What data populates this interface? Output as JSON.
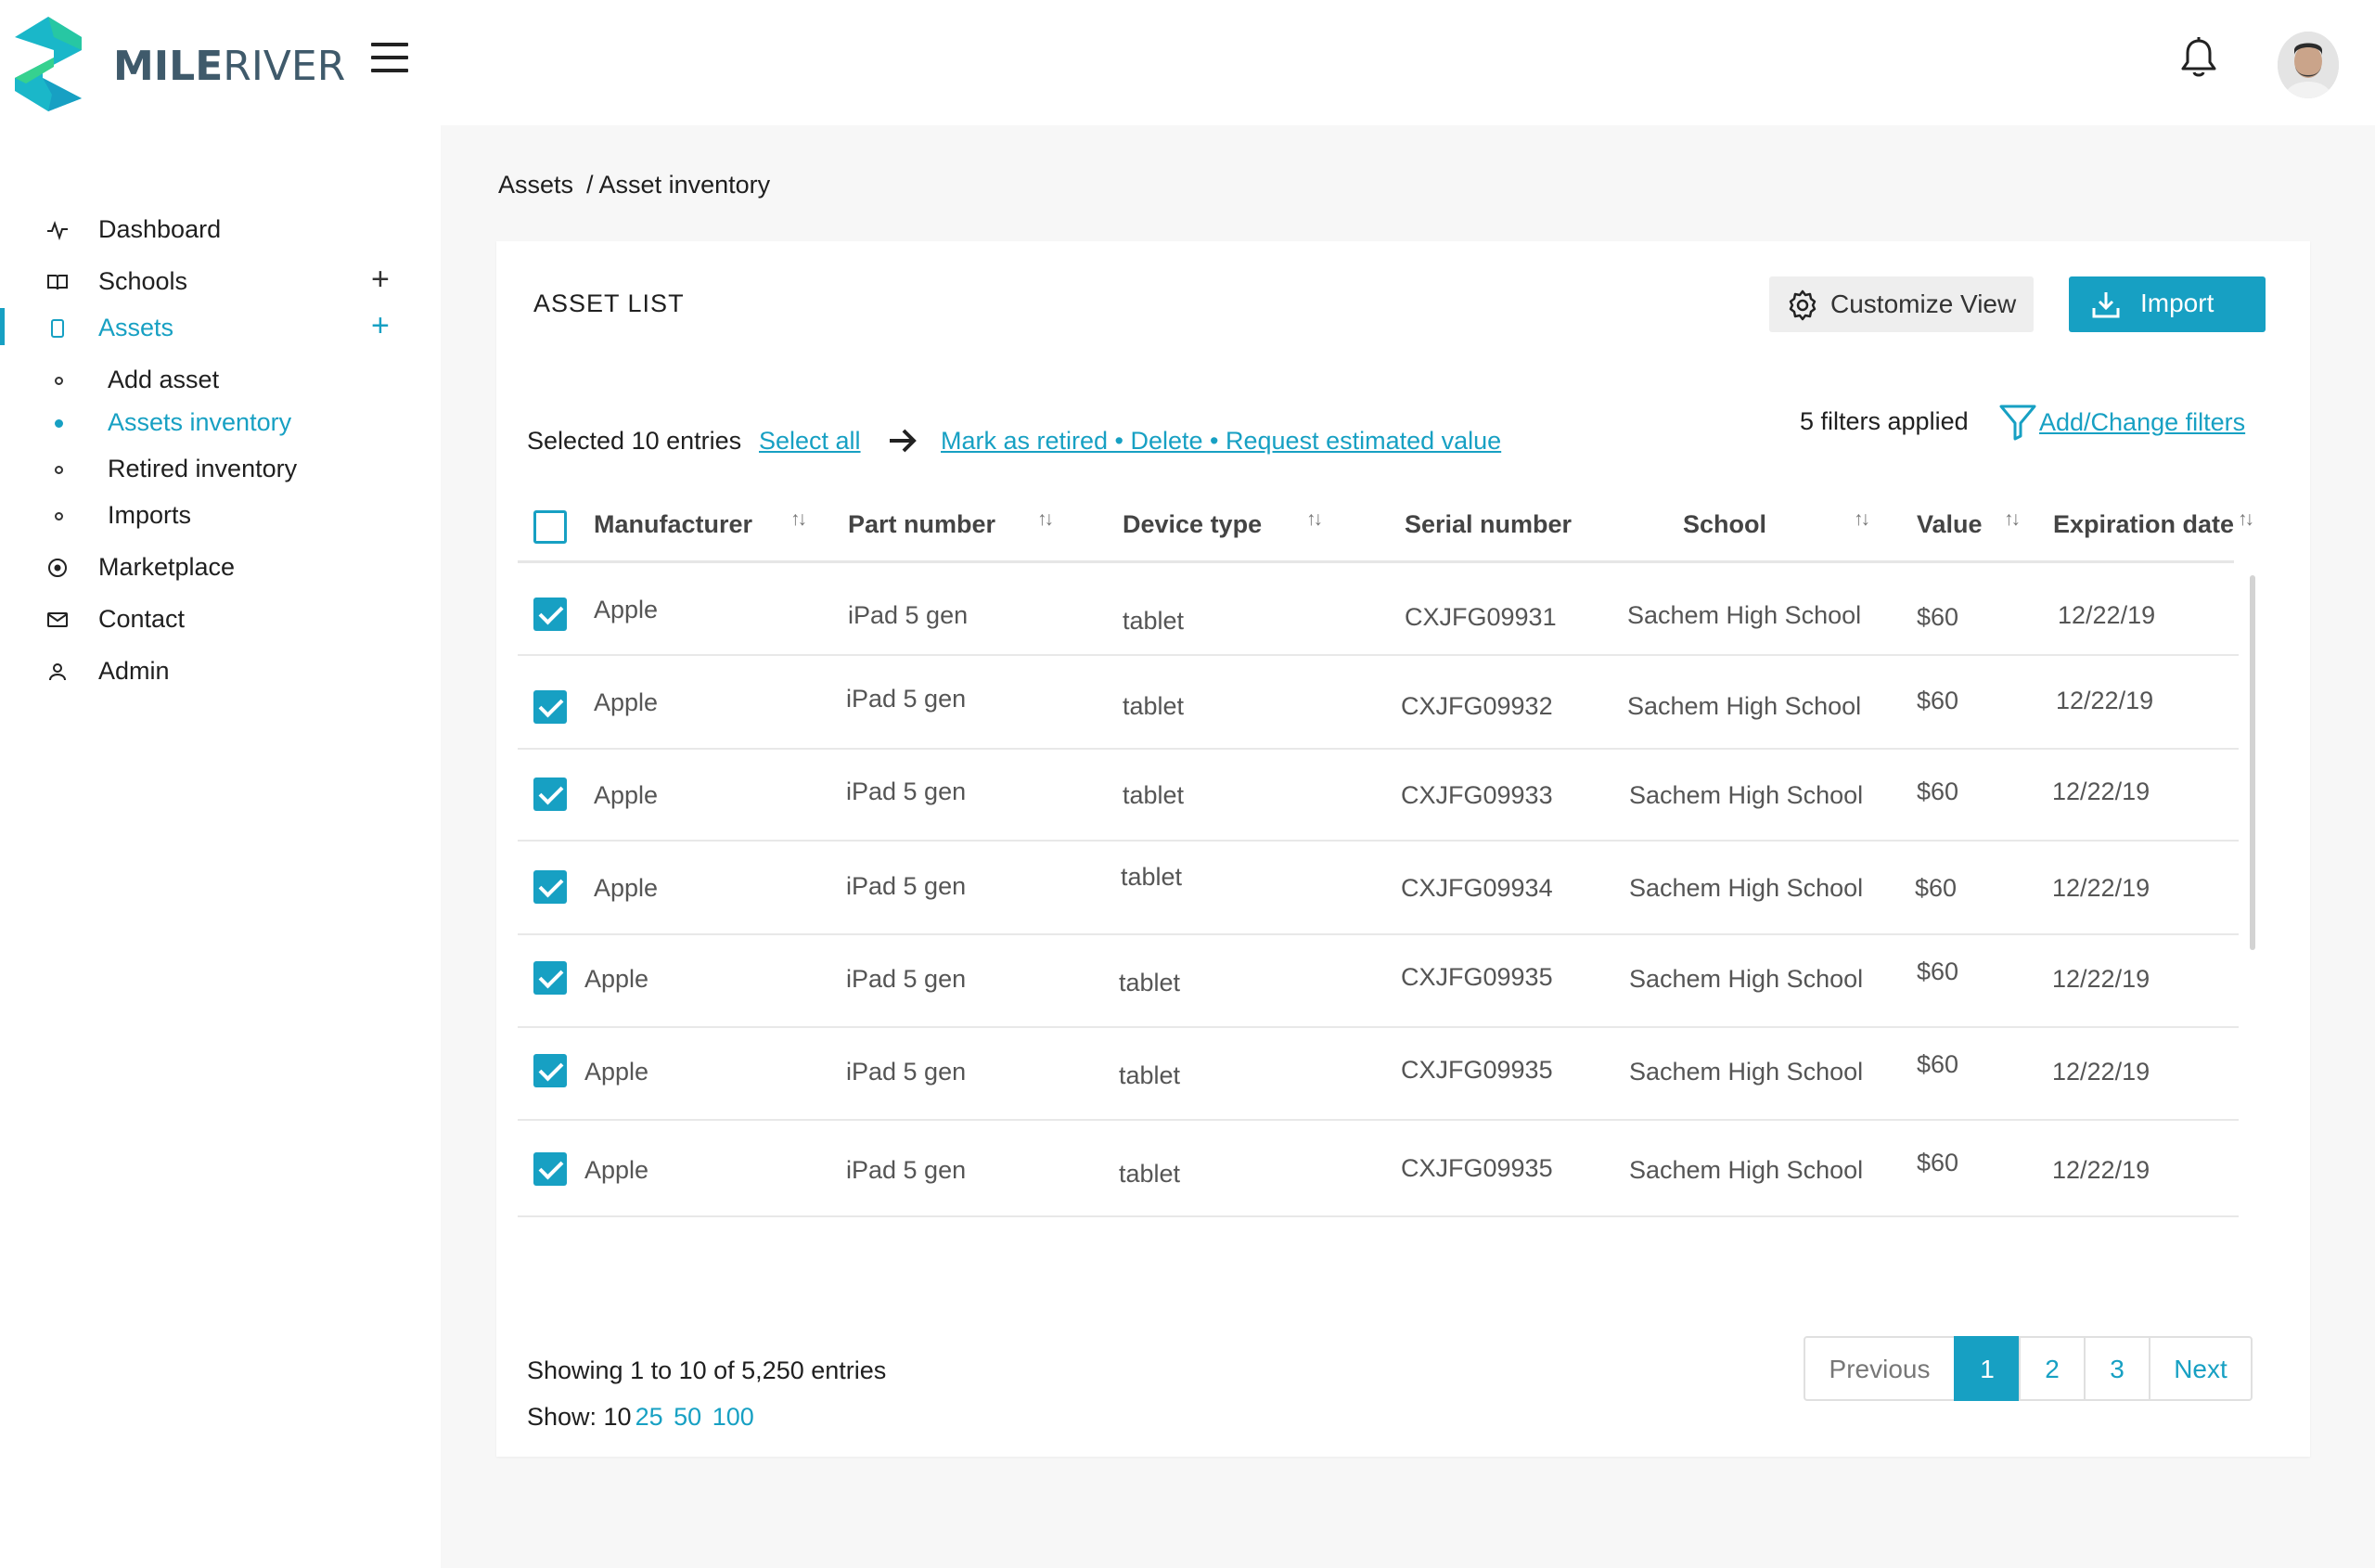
{
  "brand": {
    "name_bold": "MILE",
    "name_regular": "RIVER",
    "accent": "#17a0c3"
  },
  "sidebar": {
    "items": [
      {
        "label": "Dashboard",
        "icon": "activity-icon"
      },
      {
        "label": "Schools",
        "icon": "book-icon",
        "expand": "+"
      },
      {
        "label": "Assets",
        "icon": "tablet-icon",
        "expand": "+",
        "active": true
      },
      {
        "label": "Marketplace",
        "icon": "target-icon"
      },
      {
        "label": "Contact",
        "icon": "mail-icon"
      },
      {
        "label": "Admin",
        "icon": "user-icon"
      }
    ],
    "subitems": [
      {
        "label": "Add asset"
      },
      {
        "label": "Assets inventory",
        "active": true
      },
      {
        "label": "Retired inventory"
      },
      {
        "label": "Imports"
      }
    ]
  },
  "breadcrumb": {
    "root": "Assets",
    "current": "/ Asset inventory"
  },
  "card": {
    "title": "ASSET LIST",
    "customize_label": "Customize View",
    "import_label": "Import"
  },
  "selection": {
    "text": "Selected 10 entries",
    "select_all": "Select all",
    "actions": "Mark as retired • Delete • Request estimated value"
  },
  "filters": {
    "count_text": "5 filters applied",
    "link": "Add/Change filters"
  },
  "table": {
    "headers": [
      "Manufacturer",
      "Part number",
      "Device type",
      "Serial number",
      "School",
      "Value",
      "Expiration date"
    ],
    "rows": [
      {
        "manufacturer": "Apple",
        "part": "iPad 5 gen",
        "type": "tablet",
        "serial": "CXJFG09931",
        "school": "Sachem High School",
        "value": "$60",
        "exp": "12/22/19",
        "checked": true
      },
      {
        "manufacturer": "Apple",
        "part": "iPad 5 gen",
        "type": "tablet",
        "serial": "CXJFG09932",
        "school": "Sachem High School",
        "value": "$60",
        "exp": "12/22/19",
        "checked": true
      },
      {
        "manufacturer": "Apple",
        "part": "iPad 5 gen",
        "type": "tablet",
        "serial": "CXJFG09933",
        "school": "Sachem High School",
        "value": "$60",
        "exp": "12/22/19",
        "checked": true
      },
      {
        "manufacturer": "Apple",
        "part": "iPad 5 gen",
        "type": "tablet",
        "serial": "CXJFG09934",
        "school": "Sachem High School",
        "value": "$60",
        "exp": "12/22/19",
        "checked": true
      },
      {
        "manufacturer": "Apple",
        "part": "iPad 5 gen",
        "type": "tablet",
        "serial": "CXJFG09935",
        "school": "Sachem High School",
        "value": "$60",
        "exp": "12/22/19",
        "checked": true
      },
      {
        "manufacturer": "Apple",
        "part": "iPad 5 gen",
        "type": "tablet",
        "serial": "CXJFG09935",
        "school": "Sachem High School",
        "value": "$60",
        "exp": "12/22/19",
        "checked": true
      },
      {
        "manufacturer": "Apple",
        "part": "iPad 5 gen",
        "type": "tablet",
        "serial": "CXJFG09935",
        "school": "Sachem High School",
        "value": "$60",
        "exp": "12/22/19",
        "checked": true
      }
    ]
  },
  "footer": {
    "showing": "Showing 1 to 10 of 5,250 entries",
    "show_label": "Show: 10",
    "show_options": [
      "25",
      "50",
      "100"
    ]
  },
  "pagination": {
    "previous": "Previous",
    "pages": [
      "1",
      "2",
      "3"
    ],
    "current": "1",
    "next": "Next"
  }
}
